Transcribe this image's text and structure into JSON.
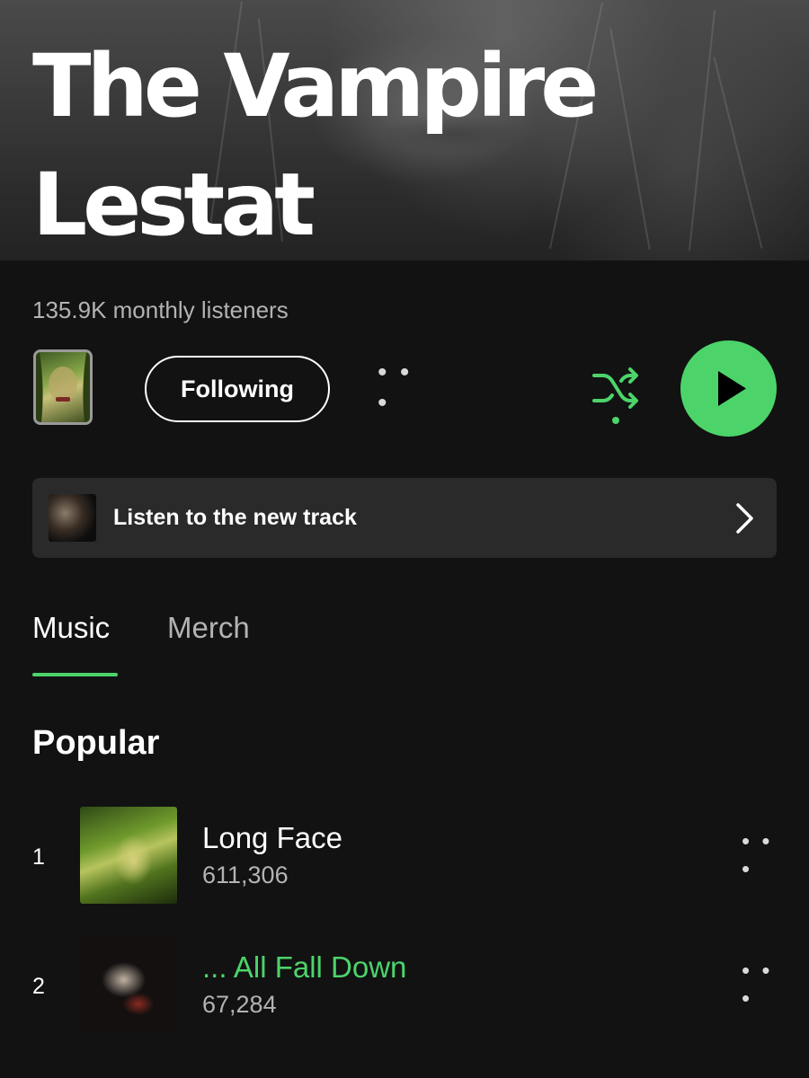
{
  "artist": {
    "name": "The Vampire\nLestat",
    "monthly_listeners": "135.9K monthly listeners"
  },
  "actions": {
    "follow_label": "Following",
    "more_glyph": "• • •"
  },
  "banner": {
    "label": "Listen to the new track"
  },
  "tabs": [
    {
      "label": "Music",
      "active": true
    },
    {
      "label": "Merch",
      "active": false
    }
  ],
  "popular": {
    "title": "Popular",
    "tracks": [
      {
        "rank": "1",
        "title": "Long Face",
        "plays": "611,306",
        "playing": false
      },
      {
        "rank": "2",
        "title": "... All Fall Down",
        "plays": "67,284",
        "playing": true
      }
    ]
  },
  "colors": {
    "accent": "#4cd46a",
    "background": "#121212",
    "banner": "#2a2a2a",
    "secondary_text": "#b3b3b3"
  },
  "icons": {
    "shuffle": "shuffle-icon",
    "play": "play-icon",
    "chevron": "chevron-right-icon",
    "more": "more-icon"
  }
}
